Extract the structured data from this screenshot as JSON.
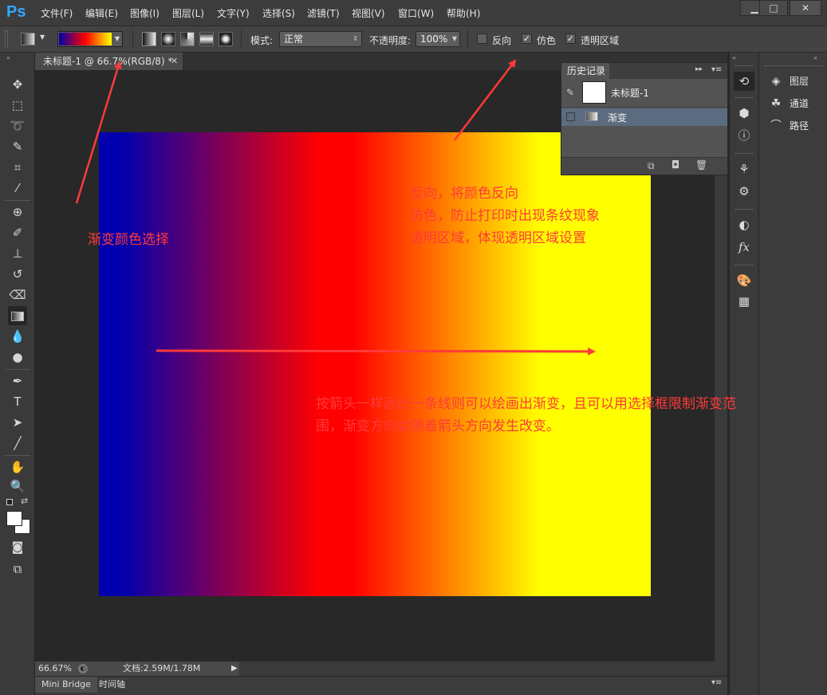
{
  "app": {
    "logo": "Ps"
  },
  "menu": [
    "文件(F)",
    "编辑(E)",
    "图像(I)",
    "图层(L)",
    "文字(Y)",
    "选择(S)",
    "滤镜(T)",
    "视图(V)",
    "窗口(W)",
    "帮助(H)"
  ],
  "window_buttons": {
    "minimize": "▁",
    "restore": "□",
    "close": "✕"
  },
  "options": {
    "mode_label": "模式:",
    "mode_value": "正常",
    "opacity_label": "不透明度:",
    "opacity_value": "100%",
    "reverse_label": "反向",
    "reverse_checked": false,
    "dither_label": "仿色",
    "dither_checked": true,
    "transparency_label": "透明区域",
    "transparency_checked": true,
    "gradient_colors": [
      "#0000a8",
      "#ff0000",
      "#ffff00"
    ]
  },
  "document": {
    "tab_title": "未标题-1 @ 66.7%(RGB/8) *",
    "close": "✕",
    "zoom": "66.67%",
    "doc_size": "文档:2.59M/1.78M",
    "gradient_stops": [
      "#0000ae",
      "#ff0000",
      "#ffff00"
    ]
  },
  "bottom_tabs": [
    "Mini Bridge",
    "时间轴"
  ],
  "history": {
    "title": "历史记录",
    "snapshot_label": "未标题-1",
    "states": [
      "渐变"
    ]
  },
  "panels": [
    {
      "icon": "layers-icon",
      "label": "图层"
    },
    {
      "icon": "channels-icon",
      "label": "通道"
    },
    {
      "icon": "paths-icon",
      "label": "路径"
    }
  ],
  "annotations": {
    "gradient_select": "渐变颜色选择",
    "options_desc": [
      "反向，将颜色反向",
      "仿色，防止打印时出现条纹现象",
      "透明区域，体现透明区域设置"
    ],
    "usage_desc": [
      "按箭头一样画出一条线则可以绘画出渐变，且可以用选择框限制渐变范",
      "围，渐变方向会随着箭头方向发生改变。"
    ]
  },
  "annotation_color": "#ff3a3a"
}
